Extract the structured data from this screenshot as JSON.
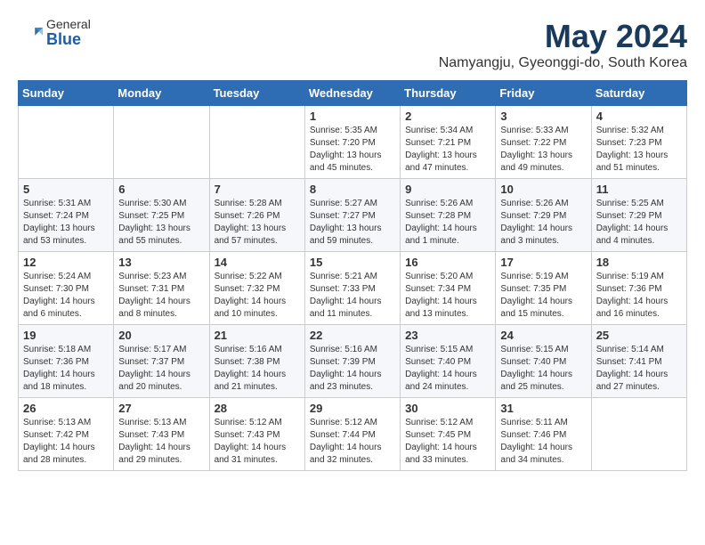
{
  "header": {
    "logo_general": "General",
    "logo_blue": "Blue",
    "title": "May 2024",
    "subtitle": "Namyangju, Gyeonggi-do, South Korea"
  },
  "days_of_week": [
    "Sunday",
    "Monday",
    "Tuesday",
    "Wednesday",
    "Thursday",
    "Friday",
    "Saturday"
  ],
  "weeks": [
    [
      {
        "day": "",
        "info": ""
      },
      {
        "day": "",
        "info": ""
      },
      {
        "day": "",
        "info": ""
      },
      {
        "day": "1",
        "info": "Sunrise: 5:35 AM\nSunset: 7:20 PM\nDaylight: 13 hours\nand 45 minutes."
      },
      {
        "day": "2",
        "info": "Sunrise: 5:34 AM\nSunset: 7:21 PM\nDaylight: 13 hours\nand 47 minutes."
      },
      {
        "day": "3",
        "info": "Sunrise: 5:33 AM\nSunset: 7:22 PM\nDaylight: 13 hours\nand 49 minutes."
      },
      {
        "day": "4",
        "info": "Sunrise: 5:32 AM\nSunset: 7:23 PM\nDaylight: 13 hours\nand 51 minutes."
      }
    ],
    [
      {
        "day": "5",
        "info": "Sunrise: 5:31 AM\nSunset: 7:24 PM\nDaylight: 13 hours\nand 53 minutes."
      },
      {
        "day": "6",
        "info": "Sunrise: 5:30 AM\nSunset: 7:25 PM\nDaylight: 13 hours\nand 55 minutes."
      },
      {
        "day": "7",
        "info": "Sunrise: 5:28 AM\nSunset: 7:26 PM\nDaylight: 13 hours\nand 57 minutes."
      },
      {
        "day": "8",
        "info": "Sunrise: 5:27 AM\nSunset: 7:27 PM\nDaylight: 13 hours\nand 59 minutes."
      },
      {
        "day": "9",
        "info": "Sunrise: 5:26 AM\nSunset: 7:28 PM\nDaylight: 14 hours\nand 1 minute."
      },
      {
        "day": "10",
        "info": "Sunrise: 5:26 AM\nSunset: 7:29 PM\nDaylight: 14 hours\nand 3 minutes."
      },
      {
        "day": "11",
        "info": "Sunrise: 5:25 AM\nSunset: 7:29 PM\nDaylight: 14 hours\nand 4 minutes."
      }
    ],
    [
      {
        "day": "12",
        "info": "Sunrise: 5:24 AM\nSunset: 7:30 PM\nDaylight: 14 hours\nand 6 minutes."
      },
      {
        "day": "13",
        "info": "Sunrise: 5:23 AM\nSunset: 7:31 PM\nDaylight: 14 hours\nand 8 minutes."
      },
      {
        "day": "14",
        "info": "Sunrise: 5:22 AM\nSunset: 7:32 PM\nDaylight: 14 hours\nand 10 minutes."
      },
      {
        "day": "15",
        "info": "Sunrise: 5:21 AM\nSunset: 7:33 PM\nDaylight: 14 hours\nand 11 minutes."
      },
      {
        "day": "16",
        "info": "Sunrise: 5:20 AM\nSunset: 7:34 PM\nDaylight: 14 hours\nand 13 minutes."
      },
      {
        "day": "17",
        "info": "Sunrise: 5:19 AM\nSunset: 7:35 PM\nDaylight: 14 hours\nand 15 minutes."
      },
      {
        "day": "18",
        "info": "Sunrise: 5:19 AM\nSunset: 7:36 PM\nDaylight: 14 hours\nand 16 minutes."
      }
    ],
    [
      {
        "day": "19",
        "info": "Sunrise: 5:18 AM\nSunset: 7:36 PM\nDaylight: 14 hours\nand 18 minutes."
      },
      {
        "day": "20",
        "info": "Sunrise: 5:17 AM\nSunset: 7:37 PM\nDaylight: 14 hours\nand 20 minutes."
      },
      {
        "day": "21",
        "info": "Sunrise: 5:16 AM\nSunset: 7:38 PM\nDaylight: 14 hours\nand 21 minutes."
      },
      {
        "day": "22",
        "info": "Sunrise: 5:16 AM\nSunset: 7:39 PM\nDaylight: 14 hours\nand 23 minutes."
      },
      {
        "day": "23",
        "info": "Sunrise: 5:15 AM\nSunset: 7:40 PM\nDaylight: 14 hours\nand 24 minutes."
      },
      {
        "day": "24",
        "info": "Sunrise: 5:15 AM\nSunset: 7:40 PM\nDaylight: 14 hours\nand 25 minutes."
      },
      {
        "day": "25",
        "info": "Sunrise: 5:14 AM\nSunset: 7:41 PM\nDaylight: 14 hours\nand 27 minutes."
      }
    ],
    [
      {
        "day": "26",
        "info": "Sunrise: 5:13 AM\nSunset: 7:42 PM\nDaylight: 14 hours\nand 28 minutes."
      },
      {
        "day": "27",
        "info": "Sunrise: 5:13 AM\nSunset: 7:43 PM\nDaylight: 14 hours\nand 29 minutes."
      },
      {
        "day": "28",
        "info": "Sunrise: 5:12 AM\nSunset: 7:43 PM\nDaylight: 14 hours\nand 31 minutes."
      },
      {
        "day": "29",
        "info": "Sunrise: 5:12 AM\nSunset: 7:44 PM\nDaylight: 14 hours\nand 32 minutes."
      },
      {
        "day": "30",
        "info": "Sunrise: 5:12 AM\nSunset: 7:45 PM\nDaylight: 14 hours\nand 33 minutes."
      },
      {
        "day": "31",
        "info": "Sunrise: 5:11 AM\nSunset: 7:46 PM\nDaylight: 14 hours\nand 34 minutes."
      },
      {
        "day": "",
        "info": ""
      }
    ]
  ]
}
